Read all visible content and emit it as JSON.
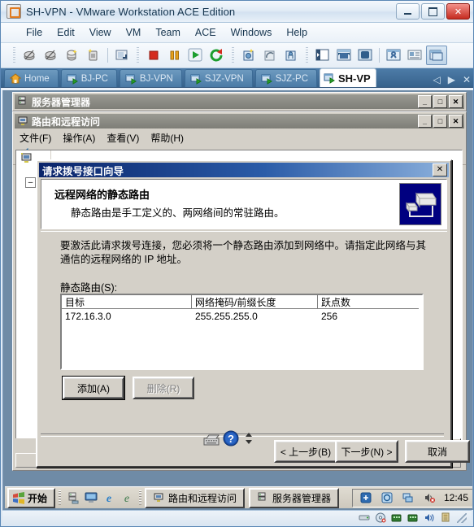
{
  "vmware": {
    "title": "SH-VPN - VMware Workstation ACE Edition",
    "app_icon": "vmware-icon",
    "window_buttons": [
      {
        "name": "minimize-button",
        "label": "–"
      },
      {
        "name": "maximize-button",
        "label": "□"
      },
      {
        "name": "close-button",
        "label": "✕"
      }
    ],
    "menu": [
      "File",
      "Edit",
      "View",
      "VM",
      "Team",
      "ACE",
      "Windows",
      "Help"
    ],
    "toolbar_icons": [
      "power-off-guest-icon",
      "suspend-guest-icon",
      "snapshot-take-icon",
      "snapshot-manage-icon",
      "fullscreen-toggle-icon",
      "stop-icon",
      "pause-icon",
      "play-icon",
      "reset-icon",
      "snapshot-icon",
      "revert-snapshot-icon",
      "snapshot-manager-icon",
      "show-sidebar-icon",
      "quick-switch-icon",
      "fullscreen-icon",
      "settings-icon",
      "summary-icon",
      "console-view-icon"
    ],
    "tabs": [
      {
        "label": "Home",
        "icon": "home-icon",
        "active": false
      },
      {
        "label": "BJ-PC",
        "icon": "vm-icon",
        "active": false
      },
      {
        "label": "BJ-VPN",
        "icon": "vm-icon",
        "active": false
      },
      {
        "label": "SJZ-VPN",
        "icon": "vm-icon",
        "active": false
      },
      {
        "label": "SJZ-PC",
        "icon": "vm-icon",
        "active": false
      },
      {
        "label": "SH-VP",
        "icon": "vm-icon",
        "active": true
      }
    ],
    "tab_nav": {
      "prev": "◁",
      "next": "▶",
      "close": "✕"
    }
  },
  "server_manager": {
    "title": "服务器管理器",
    "icon": "server-manager-icon",
    "buttons": [
      {
        "name": "minimize-button",
        "label": "_"
      },
      {
        "name": "restore-button",
        "label": "□"
      },
      {
        "name": "close-button",
        "label": "✕"
      }
    ]
  },
  "rras": {
    "title": "路由和远程访问",
    "icon": "rras-icon",
    "buttons": [
      {
        "name": "minimize-button",
        "label": "_"
      },
      {
        "name": "restore-button",
        "label": "□"
      },
      {
        "name": "close-button",
        "label": "✕"
      }
    ],
    "menu": [
      "文件(F)",
      "操作(A)",
      "查看(V)",
      "帮助(H)"
    ],
    "toolbar_icons": [
      "back-arrow-icon",
      "forward-arrow-icon",
      "up-icon",
      "show-tree-icon",
      "refresh-icon",
      "export-icon",
      "help-icon"
    ],
    "status_panes": [
      "",
      "",
      ""
    ]
  },
  "wizard": {
    "title": "请求拨号接口向导",
    "close_label": "✕",
    "header": {
      "title": "远程网络的静态路由",
      "subtitle": "静态路由是手工定义的、两网络间的常驻路由。",
      "icon": "network-route-icon",
      "icon_bg": "#000080"
    },
    "paragraph": "要激活此请求拨号连接，您必须将一个静态路由添加到网络中。请指定此网络与其通信的远程网络的 IP 地址。",
    "list_label": "静态路由(S):",
    "table": {
      "columns": [
        "目标",
        "网络掩码/前缀长度",
        "跃点数"
      ],
      "rows": [
        [
          "172.16.3.0",
          "255.255.255.0",
          "256"
        ]
      ]
    },
    "add_button": "添加(A)",
    "delete_button": "删除(R)",
    "back_button": "< 上一步(B)",
    "next_button": "下一步(N) >",
    "cancel_button": "取消"
  },
  "taskbar": {
    "start_label": "开始",
    "start_icon": "windows-flag-icon",
    "quick_launch": [
      "show-desktop-icon",
      "desktop-icon",
      "internet-explorer-icon",
      "ie-alt-icon"
    ],
    "tasks": [
      {
        "label": "路由和远程访问",
        "icon": "rras-icon"
      },
      {
        "label": "服务器管理器",
        "icon": "server-manager-icon"
      }
    ],
    "tray_icons": [
      "network-config-icon",
      "network-icon",
      "network-disconnected-icon",
      "volume-muted-icon"
    ],
    "time": "12:45"
  },
  "vm_status": {
    "icons": [
      "hard-disk-icon",
      "cd-dvd-icon",
      "network-adapter-icon",
      "network-adapter2-icon",
      "sound-icon",
      "usb-icon"
    ]
  },
  "colors": {
    "vmware_tabbar": "#4d7ca8",
    "dialog_title_start": "#0a246a",
    "dialog_title_end": "#8bb0dc",
    "classic_face": "#d4d0c8",
    "mmc_title": "#8a8a83"
  }
}
